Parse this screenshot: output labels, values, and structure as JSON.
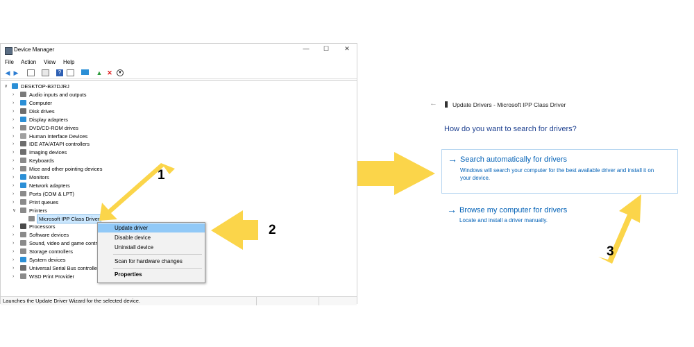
{
  "device_manager": {
    "title": "Device Manager",
    "menu": [
      "File",
      "Action",
      "View",
      "Help"
    ],
    "root": "DESKTOP-B37DJRJ",
    "tree": [
      {
        "label": "Audio inputs and outputs",
        "expanded": false,
        "color": "#7a7a7a"
      },
      {
        "label": "Computer",
        "expanded": false,
        "color": "#2b8fd6"
      },
      {
        "label": "Disk drives",
        "expanded": false,
        "color": "#6d6d6d"
      },
      {
        "label": "Display adapters",
        "expanded": false,
        "color": "#2b8fd6"
      },
      {
        "label": "DVD/CD-ROM drives",
        "expanded": false,
        "color": "#8a8a8a"
      },
      {
        "label": "Human Interface Devices",
        "expanded": false,
        "color": "#a0a0a0"
      },
      {
        "label": "IDE ATA/ATAPI controllers",
        "expanded": false,
        "color": "#6d6d6d"
      },
      {
        "label": "Imaging devices",
        "expanded": false,
        "color": "#6d6d6d"
      },
      {
        "label": "Keyboards",
        "expanded": false,
        "color": "#8a8a8a"
      },
      {
        "label": "Mice and other pointing devices",
        "expanded": false,
        "color": "#8a8a8a"
      },
      {
        "label": "Monitors",
        "expanded": false,
        "color": "#2b8fd6"
      },
      {
        "label": "Network adapters",
        "expanded": false,
        "color": "#2b8fd6"
      },
      {
        "label": "Ports (COM & LPT)",
        "expanded": false,
        "color": "#8a8a8a"
      },
      {
        "label": "Print queues",
        "expanded": false,
        "color": "#8a8a8a"
      },
      {
        "label": "Printers",
        "expanded": true,
        "color": "#8a8a8a"
      },
      {
        "label": "Microsoft IPP Class Driver",
        "child": true,
        "selected": true,
        "color": "#8a8a8a"
      },
      {
        "label": "Processors",
        "expanded": false,
        "color": "#4a4a4a"
      },
      {
        "label": "Software devices",
        "expanded": false,
        "color": "#8a8a8a"
      },
      {
        "label": "Sound, video and game contr",
        "expanded": false,
        "color": "#8a8a8a"
      },
      {
        "label": "Storage controllers",
        "expanded": false,
        "color": "#8a8a8a"
      },
      {
        "label": "System devices",
        "expanded": false,
        "color": "#2b8fd6"
      },
      {
        "label": "Universal Serial Bus controlle",
        "expanded": false,
        "color": "#6d6d6d"
      },
      {
        "label": "WSD Print Provider",
        "expanded": false,
        "color": "#8a8a8a"
      }
    ],
    "status": "Launches the Update Driver Wizard for the selected device."
  },
  "context_menu": {
    "update": "Update driver",
    "disable": "Disable device",
    "uninstall": "Uninstall device",
    "scan": "Scan for hardware changes",
    "properties": "Properties"
  },
  "steps": {
    "one": "1",
    "two": "2",
    "three": "3"
  },
  "update_drivers": {
    "back": "←",
    "title": "Update Drivers - Microsoft IPP Class Driver",
    "question": "How do you want to search for drivers?",
    "option1": {
      "arrow": "→",
      "heading": "Search automatically for drivers",
      "line1": "Windows will search your computer for the best available driver and install it on",
      "line2": "your device."
    },
    "option2": {
      "arrow": "→",
      "heading": "Browse my computer for drivers",
      "desc": "Locate and install a driver manually."
    }
  },
  "colors": {
    "arrow": "#fbd54a",
    "link": "#0060b6",
    "selected": "#cce8ff",
    "menu_highlight": "#91c9f7"
  }
}
